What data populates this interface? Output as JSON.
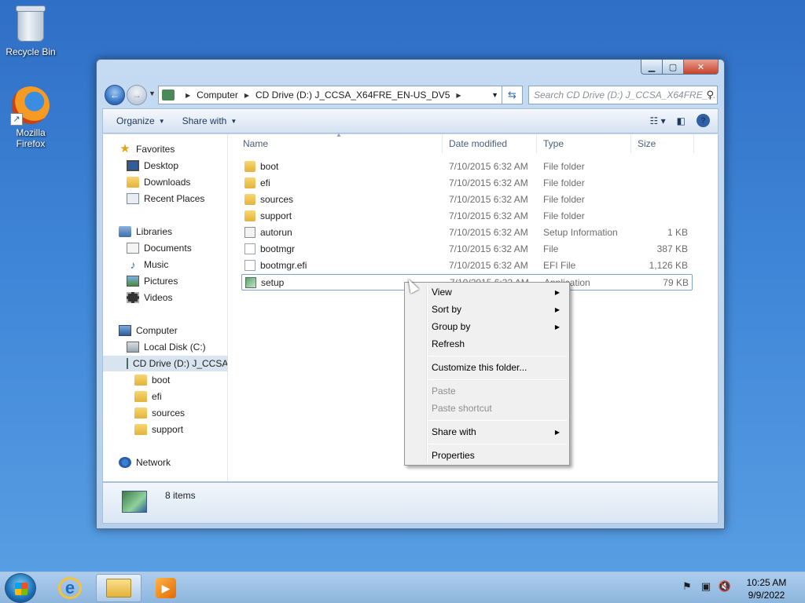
{
  "desktop": {
    "icons": [
      {
        "label": "Recycle Bin",
        "icon": "recycle-bin-icon"
      },
      {
        "label": "Mozilla Firefox",
        "icon": "firefox-icon"
      }
    ]
  },
  "window": {
    "caption": {
      "minimize": "▁",
      "maximize": "▢",
      "close": "✕"
    },
    "address": {
      "segments": [
        "Computer",
        "CD Drive (D:) J_CCSA_X64FRE_EN-US_DV5"
      ],
      "separator": "▶"
    },
    "search": {
      "placeholder": "Search CD Drive (D:) J_CCSA_X64FRE_..."
    },
    "toolbar": {
      "organize": "Organize",
      "share_with": "Share with"
    },
    "nav": {
      "favorites": "Favorites",
      "desktop": "Desktop",
      "downloads": "Downloads",
      "recent": "Recent Places",
      "libraries": "Libraries",
      "documents": "Documents",
      "music": "Music",
      "pictures": "Pictures",
      "videos": "Videos",
      "computer": "Computer",
      "local_disk": "Local Disk (C:)",
      "cd_drive": "CD Drive (D:) J_CCSA",
      "sub": [
        "boot",
        "efi",
        "sources",
        "support"
      ],
      "network": "Network"
    },
    "columns": {
      "name": "Name",
      "date": "Date modified",
      "type": "Type",
      "size": "Size"
    },
    "files": [
      {
        "name": "boot",
        "date": "7/10/2015 6:32 AM",
        "type": "File folder",
        "size": "",
        "icon": "folder-icon"
      },
      {
        "name": "efi",
        "date": "7/10/2015 6:32 AM",
        "type": "File folder",
        "size": "",
        "icon": "folder-icon"
      },
      {
        "name": "sources",
        "date": "7/10/2015 6:32 AM",
        "type": "File folder",
        "size": "",
        "icon": "folder-icon"
      },
      {
        "name": "support",
        "date": "7/10/2015 6:32 AM",
        "type": "File folder",
        "size": "",
        "icon": "folder-icon"
      },
      {
        "name": "autorun",
        "date": "7/10/2015 6:32 AM",
        "type": "Setup Information",
        "size": "1 KB",
        "icon": "setup-info-icon"
      },
      {
        "name": "bootmgr",
        "date": "7/10/2015 6:32 AM",
        "type": "File",
        "size": "387 KB",
        "icon": "file-icon"
      },
      {
        "name": "bootmgr.efi",
        "date": "7/10/2015 6:32 AM",
        "type": "EFI File",
        "size": "1,126 KB",
        "icon": "file-icon"
      },
      {
        "name": "setup",
        "date": "7/10/2015 6:32 AM",
        "type": "Application",
        "size": "79 KB",
        "icon": "setup-app-icon"
      }
    ],
    "status": {
      "count": "8 items"
    }
  },
  "context_menu": {
    "items": [
      {
        "label": "View",
        "submenu": true,
        "enabled": true
      },
      {
        "label": "Sort by",
        "submenu": true,
        "enabled": true
      },
      {
        "label": "Group by",
        "submenu": true,
        "enabled": true
      },
      {
        "label": "Refresh",
        "submenu": false,
        "enabled": true
      },
      {
        "label": "Customize this folder...",
        "submenu": false,
        "enabled": true
      },
      {
        "label": "Paste",
        "submenu": false,
        "enabled": false
      },
      {
        "label": "Paste shortcut",
        "submenu": false,
        "enabled": false
      },
      {
        "label": "Share with",
        "submenu": true,
        "enabled": true
      },
      {
        "label": "Properties",
        "submenu": false,
        "enabled": true
      }
    ]
  },
  "taskbar": {
    "clock": {
      "time": "10:25 AM",
      "date": "9/9/2022"
    }
  }
}
